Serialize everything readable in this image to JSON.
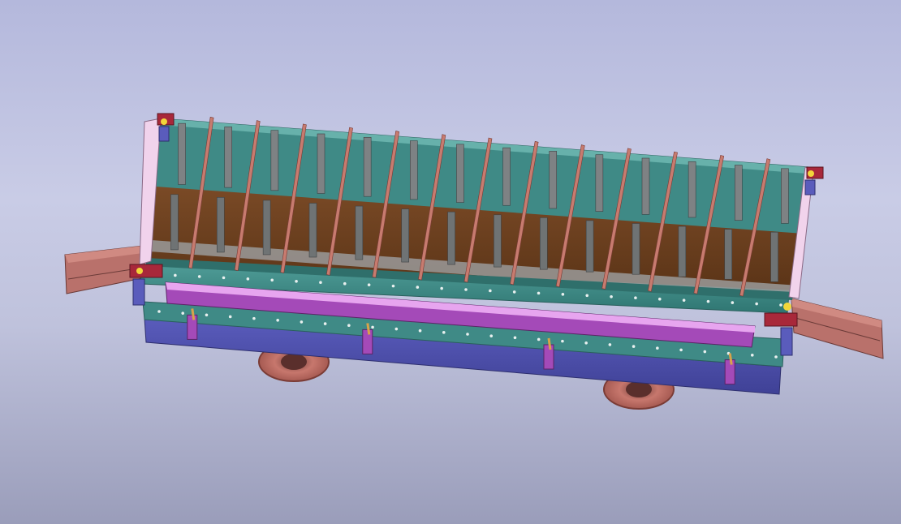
{
  "scene": {
    "type": "cad-3d-model",
    "subject": "rail-cart-with-divided-mould",
    "compartment_count": 14,
    "wheel_count_visible": 2,
    "colors": {
      "background_top": "#b4b8dc",
      "background_bottom": "#9a9dba",
      "frame_teal": "#3f8a86",
      "divider_panel": "#6f4120",
      "divider_rib": "#c77b6f",
      "base_purple": "#4a4ca6",
      "rail_magenta": "#a44ab8",
      "bracket_salmon": "#b9716b",
      "wheel": "#c7776d",
      "clamp_red": "#a8283a",
      "accent_yellow": "#f2d63a"
    }
  }
}
